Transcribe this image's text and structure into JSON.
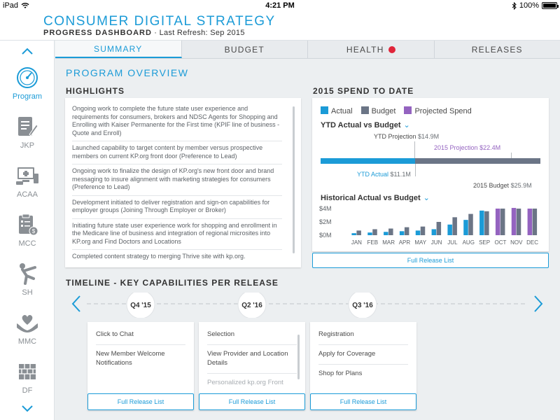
{
  "status_bar": {
    "device": "iPad",
    "time": "4:21 PM",
    "battery": "100%"
  },
  "header": {
    "title": "CONSUMER DIGITAL STRATEGY",
    "subtitle_bold": "PROGRESS DASHBOARD",
    "subtitle_rest": " · Last Refresh: Sep 2015"
  },
  "sidebar": {
    "items": [
      {
        "label": "Program",
        "icon": "gauge-icon"
      },
      {
        "label": "JKP",
        "icon": "document-pen-icon"
      },
      {
        "label": "ACAA",
        "icon": "monitor-devices-icon"
      },
      {
        "label": "MCC",
        "icon": "clipboard-dollar-icon"
      },
      {
        "label": "SH",
        "icon": "stretching-person-icon"
      },
      {
        "label": "MMC",
        "icon": "heart-hands-icon"
      },
      {
        "label": "DF",
        "icon": "brick-wall-icon"
      }
    ]
  },
  "tabs": [
    {
      "label": "SUMMARY"
    },
    {
      "label": "BUDGET"
    },
    {
      "label": "HEALTH"
    },
    {
      "label": "RELEASES"
    }
  ],
  "overview": {
    "title": "PROGRAM OVERVIEW",
    "highlights_title": "HIGHLIGHTS",
    "highlights": [
      "Ongoing work to complete the future state user experience and requirements for consumers, brokers and NDSC Agents for Shopping and Enrolling with Kaiser Permanente for the First time (KPIF line of business - Quote and Enroll)",
      "Launched capability to target content by member versus prospective members on current KP.org front door (Preference to Lead)",
      "Ongoing work to finalize the design of KP.org's new front door and brand messaging to insure alignment with marketing strategies for consumers (Preference to Lead)",
      "Development initiated to deliver registration and sign-on capabilities for employer groups (Joining Through Employer or Broker)",
      "Initiating future state user experience work for shopping and enrollment in the Medicare line of business and integration of regional microsites into KP.org and Find Doctors and Locations",
      "Completed content strategy to merging Thrive site with kp.org."
    ]
  },
  "spend": {
    "title": "2015 SPEND TO DATE",
    "legend": {
      "actual": "Actual",
      "budget": "Budget",
      "projected": "Projected Spend"
    },
    "ytd_heading": "YTD Actual vs Budget",
    "ytd_projection_label": "YTD Projection",
    "ytd_projection_value": "$14.9M",
    "projection_2015_label": "2015 Projection",
    "projection_2015_value": "$22.4M",
    "ytd_actual_label": "YTD Actual",
    "ytd_actual_value": "$11.1M",
    "budget_2015_label": "2015 Budget",
    "budget_2015_value": "$25.9M",
    "historical_heading": "Historical Actual vs Budget",
    "button": "Full Release List"
  },
  "colors": {
    "accent": "#1b9bd7",
    "actual": "#1b9bd7",
    "budget": "#6b7586",
    "projected": "#9463c0",
    "alert": "#e0253a"
  },
  "chart_data": [
    {
      "type": "bar",
      "orientation": "horizontal",
      "title": "YTD Actual vs Budget",
      "series": [
        {
          "name": "YTD Actual",
          "values": [
            11.1
          ]
        },
        {
          "name": "YTD Projection",
          "values": [
            14.9
          ]
        },
        {
          "name": "2015 Projection",
          "values": [
            22.4
          ]
        },
        {
          "name": "2015 Budget",
          "values": [
            25.9
          ]
        }
      ],
      "unit": "$M",
      "xlim": [
        0,
        25.9
      ]
    },
    {
      "type": "bar",
      "title": "Historical Actual vs Budget",
      "categories": [
        "JAN",
        "FEB",
        "MAR",
        "APR",
        "MAY",
        "JUN",
        "JUL",
        "AUG",
        "SEP",
        "OCT",
        "NOV",
        "DEC"
      ],
      "series": [
        {
          "name": "Actual",
          "values": [
            0.3,
            0.4,
            0.5,
            0.6,
            0.7,
            0.9,
            1.6,
            2.3,
            3.7,
            null,
            null,
            null
          ]
        },
        {
          "name": "Budget",
          "values": [
            0.7,
            0.9,
            1.0,
            1.2,
            1.3,
            2.0,
            2.7,
            3.2,
            3.6,
            4.0,
            4.0,
            4.0
          ]
        },
        {
          "name": "Projected Spend",
          "values": [
            null,
            null,
            null,
            null,
            null,
            null,
            null,
            null,
            null,
            4.0,
            4.1,
            4.0
          ]
        }
      ],
      "yticks": [
        "$0M",
        "$2M",
        "$4M"
      ],
      "ylim": [
        0,
        4
      ],
      "legend": "top-left"
    }
  ],
  "timeline": {
    "title": "TIMELINE - KEY CAPABILITIES PER RELEASE",
    "releases": [
      {
        "label": "Q4 '15",
        "items": [
          "Click to Chat",
          "New Member Welcome Notifications"
        ],
        "button": "Full Release List"
      },
      {
        "label": "Q2 '16",
        "items": [
          "Selection",
          "View Provider and Location Details",
          "Personalized kp.org Front"
        ],
        "button": "Full Release List"
      },
      {
        "label": "Q3 '16",
        "items": [
          "Registration",
          "Apply for Coverage",
          "Shop for Plans"
        ],
        "button": "Full Release List"
      }
    ]
  }
}
